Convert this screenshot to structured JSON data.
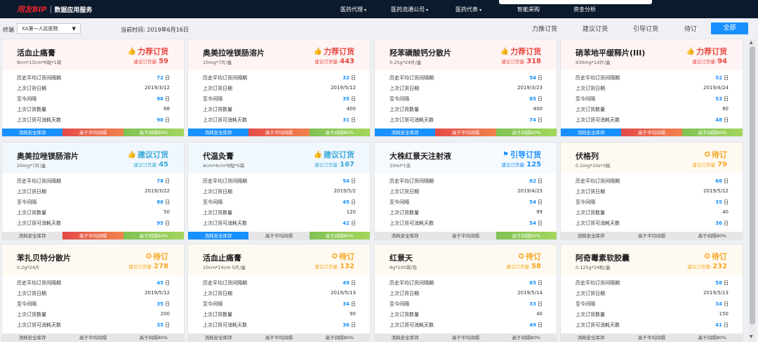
{
  "header": {
    "brand": "用友BIP",
    "subtitle": "数据应用服务",
    "nav": [
      {
        "label": "医药代理",
        "caret": "▾"
      },
      {
        "label": "医药流通公司",
        "caret": "▾"
      },
      {
        "label": "医药代表",
        "caret": "▾"
      },
      {
        "label": "智能采购",
        "caret": ""
      },
      {
        "label": "资金分析",
        "caret": ""
      }
    ]
  },
  "filter": {
    "terminal_label": "终端",
    "terminal_value": "XA第一人民医院",
    "date_label": "当前时间: 2019年6月16日",
    "buttons": [
      "力推订货",
      "建议订货",
      "引导订货",
      "待订",
      "全部"
    ],
    "active_button": "全部"
  },
  "metric_labels": [
    "历史平均订货间隔期",
    "上次订货日期",
    "至今间隔",
    "上次订货数量",
    "上次订货可消耗天数"
  ],
  "qty_label": "建议订货量:",
  "day_unit": "日",
  "cards": [
    {
      "name": "活血止痛膏",
      "spec": "9cm*13cm*6贴*1袋",
      "type": "push",
      "status": "力荐订货",
      "qty": "59",
      "avg_interval": "72",
      "last_date": "2019/3/12",
      "since": "96",
      "last_qty": "68",
      "days_consume": "90",
      "footer": [
        [
          "消耗安全库存",
          "blue"
        ],
        [
          "高于平均间隔",
          "red"
        ],
        [
          "高于间隔80%",
          "green"
        ]
      ]
    },
    {
      "name": "奥美拉唑镁肠溶片",
      "spec": "10mg*7片/盒",
      "type": "push",
      "status": "力荐订货",
      "qty": "443",
      "avg_interval": "32",
      "last_date": "2019/5/12",
      "since": "35",
      "last_qty": "400",
      "days_consume": "31",
      "footer": [
        [
          "消耗安全库存",
          "blue"
        ],
        [
          "高于平均间隔",
          "red"
        ],
        [
          "高于间隔80%",
          "green"
        ]
      ]
    },
    {
      "name": "羟苯磺酸钙分散片",
      "spec": "0.25g*24片/盒",
      "type": "push",
      "status": "力荐订货",
      "qty": "318",
      "avg_interval": "54",
      "last_date": "2019/3/23",
      "since": "85",
      "last_qty": "400",
      "days_consume": "74",
      "footer": [
        [
          "消耗安全库存",
          "blue"
        ],
        [
          "高于平均间隔",
          "red"
        ],
        [
          "高于间隔80%",
          "green"
        ]
      ]
    },
    {
      "name": "硝苯地平缓释片(III)",
      "spec": "930mg*14片/盒",
      "type": "push",
      "status": "力荐订货",
      "qty": "94",
      "avg_interval": "52",
      "last_date": "2019/4/24",
      "since": "53",
      "last_qty": "80",
      "days_consume": "48",
      "footer": [
        [
          "消耗安全库存",
          "blue"
        ],
        [
          "高于平均间隔",
          "red"
        ],
        [
          "高于间隔80%",
          "green"
        ]
      ]
    },
    {
      "name": "奥美拉唑镁肠溶片",
      "spec": "20mg*7片/盒",
      "type": "suggest",
      "status": "建议订货",
      "qty": "45",
      "avg_interval": "78",
      "last_date": "2019/3/22",
      "since": "86",
      "last_qty": "50",
      "days_consume": "95",
      "footer": [
        [
          "消耗安全库存",
          "gray"
        ],
        [
          "高于平均间隔",
          "red"
        ],
        [
          "高于间隔80%",
          "green"
        ]
      ]
    },
    {
      "name": "代温灸膏",
      "spec": "4cm*4cm*8贴*5袋",
      "type": "suggest",
      "status": "建议订货",
      "qty": "167",
      "avg_interval": "54",
      "last_date": "2019/5/2",
      "since": "45",
      "last_qty": "120",
      "days_consume": "42",
      "footer": [
        [
          "消耗安全库存",
          "blue"
        ],
        [
          "高于平均间隔",
          "gray"
        ],
        [
          "高于间隔80%",
          "green"
        ]
      ]
    },
    {
      "name": "大株红景天注射液",
      "spec": "10ml*1支",
      "type": "guide",
      "status": "引导订货",
      "qty": "125",
      "avg_interval": "62",
      "last_date": "2019/4/23",
      "since": "54",
      "last_qty": "99",
      "days_consume": "54",
      "footer": [
        [
          "消耗安全库存",
          "gray"
        ],
        [
          "高于平均间隔",
          "gray"
        ],
        [
          "高于间隔80%",
          "green"
        ]
      ]
    },
    {
      "name": "伏格列",
      "spec": "0.2mg*10s*3板",
      "type": "pending",
      "status": "待订",
      "qty": "79",
      "avg_interval": "66",
      "last_date": "2019/5/12",
      "since": "35",
      "last_qty": "40",
      "days_consume": "36",
      "footer": [
        [
          "消耗安全库存",
          "gray"
        ],
        [
          "高于平均间隔",
          "gray"
        ],
        [
          "高于间隔80%",
          "gray"
        ]
      ]
    },
    {
      "name": "苯扎贝特分散片",
      "spec": "0.2g*24片",
      "type": "pending",
      "status": "待订",
      "qty": "278",
      "avg_interval": "45",
      "last_date": "2019/5/12",
      "since": "35",
      "last_qty": "200",
      "days_consume": "35",
      "footer": [
        [
          "消耗安全库存",
          "gray"
        ],
        [
          "高于平均间隔",
          "gray"
        ],
        [
          "高于间隔80%",
          "gray"
        ]
      ]
    },
    {
      "name": "活血止痛膏",
      "spec": "10cm*14cm 5片/盒",
      "type": "pending",
      "status": "待订",
      "qty": "132",
      "avg_interval": "49",
      "last_date": "2019/5/13",
      "since": "34",
      "last_qty": "90",
      "days_consume": "36",
      "footer": [
        [
          "消耗安全库存",
          "gray"
        ],
        [
          "高于平均间隔",
          "gray"
        ],
        [
          "高于间隔80%",
          "gray"
        ]
      ]
    },
    {
      "name": "红景天",
      "spec": "6g*100袋/包",
      "type": "pending",
      "status": "待订",
      "qty": "58",
      "avg_interval": "65",
      "last_date": "2019/5/14",
      "since": "33",
      "last_qty": "40",
      "days_consume": "49",
      "footer": [
        [
          "消耗安全库存",
          "gray"
        ],
        [
          "高于平均间隔",
          "gray"
        ],
        [
          "高于间隔80%",
          "gray"
        ]
      ]
    },
    {
      "name": "阿奇霉素软胶囊",
      "spec": "0.125g*24粒/盒",
      "type": "pending",
      "status": "待订",
      "qty": "232",
      "avg_interval": "58",
      "last_date": "2019/5/13",
      "since": "34",
      "last_qty": "150",
      "days_consume": "41",
      "footer": [
        [
          "消耗安全库存",
          "gray"
        ],
        [
          "高于平均间隔",
          "gray"
        ],
        [
          "高于间隔80%",
          "gray"
        ]
      ]
    }
  ],
  "icons": {
    "push": "thumbs-up-icon",
    "suggest": "thumbs-up-icon",
    "guide": "flag-icon",
    "pending": "clock-circle-icon",
    "dropdown": "caret-down-icon"
  },
  "colors": {
    "push": "#e8473f",
    "suggest": "#3aa8d8",
    "guide": "#1890ff",
    "pending": "#f5a623",
    "accent": "#1890ff",
    "nav_bg": "#0b1a2c"
  }
}
